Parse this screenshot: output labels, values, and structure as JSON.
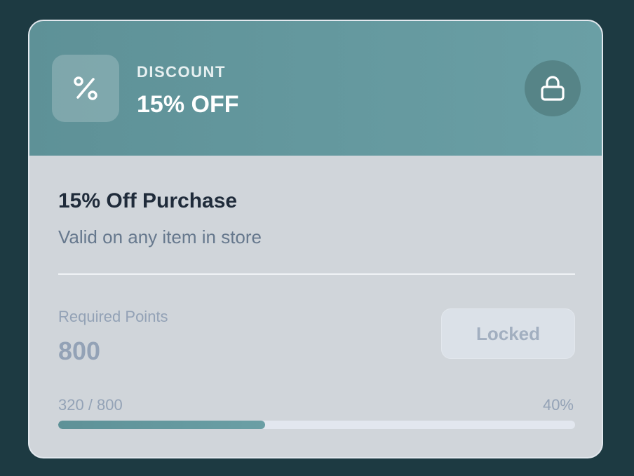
{
  "reward": {
    "icon": "percent-icon",
    "kicker": "DISCOUNT",
    "headline": "15% OFF",
    "status_icon": "lock-icon",
    "title": "15% Off Purchase",
    "description": "Valid on any item in store"
  },
  "requirements": {
    "label": "Required Points",
    "value": "800"
  },
  "action": {
    "label": "Locked"
  },
  "progress": {
    "count_text": "320 / 800",
    "percent_text": "40%",
    "fraction": 0.4
  },
  "colors": {
    "background": "#1d3a42",
    "accent": "#6a9fa5",
    "card": "#d0d5da"
  }
}
